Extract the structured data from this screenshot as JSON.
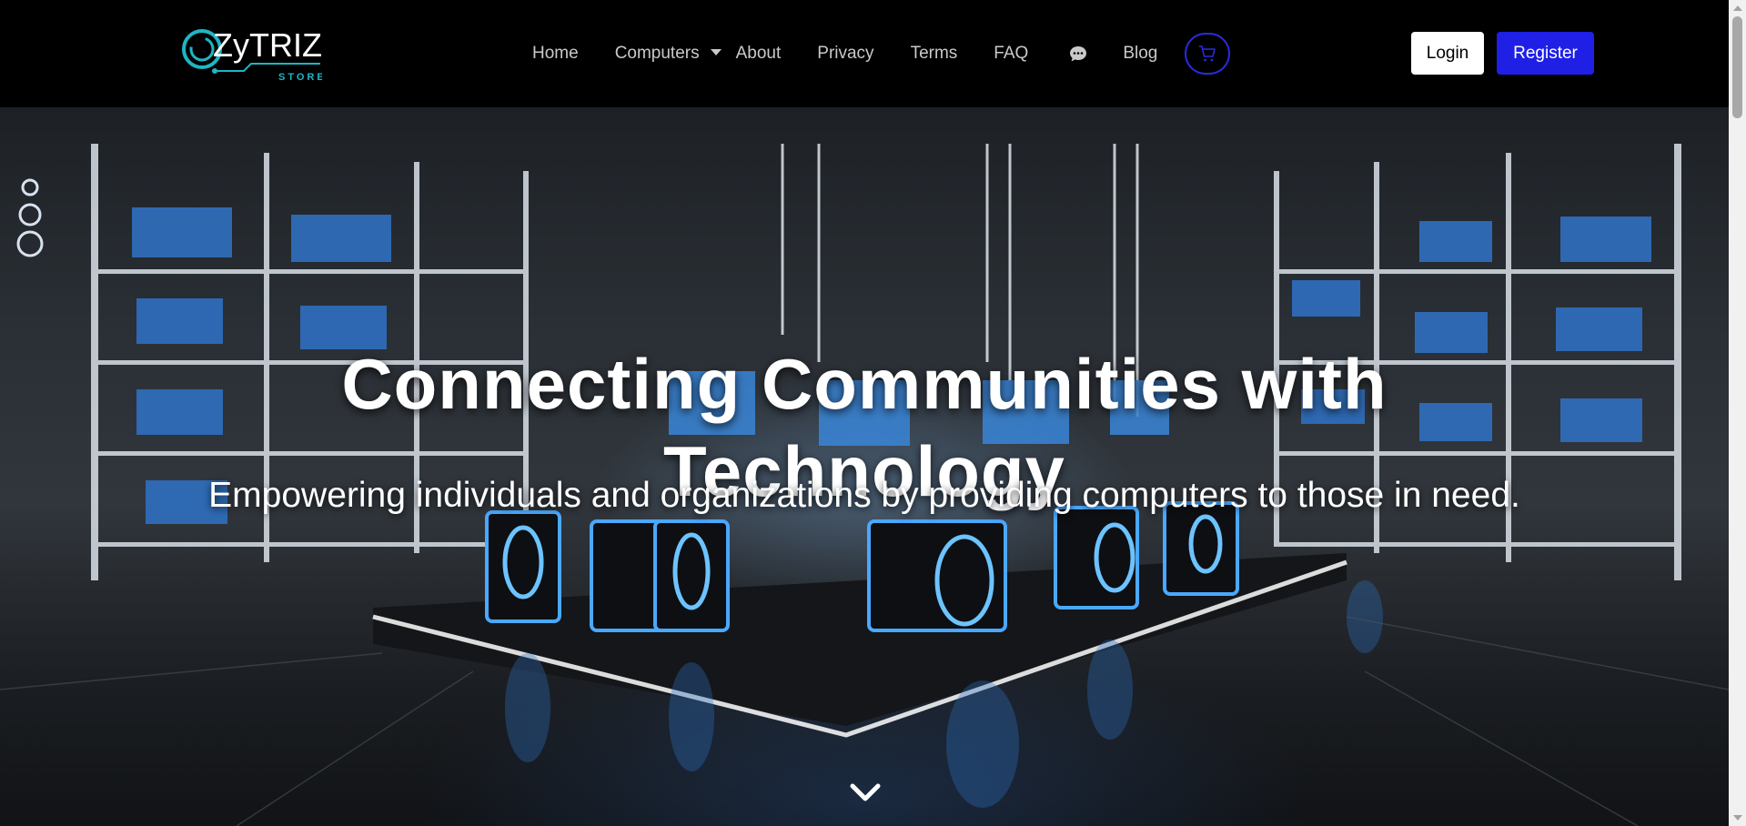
{
  "brand": {
    "logo_text": "ZyTRIZ",
    "logo_subtext": "STORE",
    "accent_color": "#1fb5c4"
  },
  "nav": {
    "links": [
      "Home",
      "Computers",
      "About",
      "Privacy",
      "Terms",
      "FAQ",
      "Blog"
    ],
    "chat_icon": "chat-bubble-icon",
    "cart_icon": "shopping-cart-icon",
    "login_label": "Login",
    "register_label": "Register",
    "register_color": "#1f1fe6"
  },
  "hero": {
    "title_line1": "Connecting Communities with",
    "title_line2": "Technology",
    "subtitle": "Empowering individuals and organizations by providing computers to those in need.",
    "scroll_icon": "chevron-down-icon"
  }
}
